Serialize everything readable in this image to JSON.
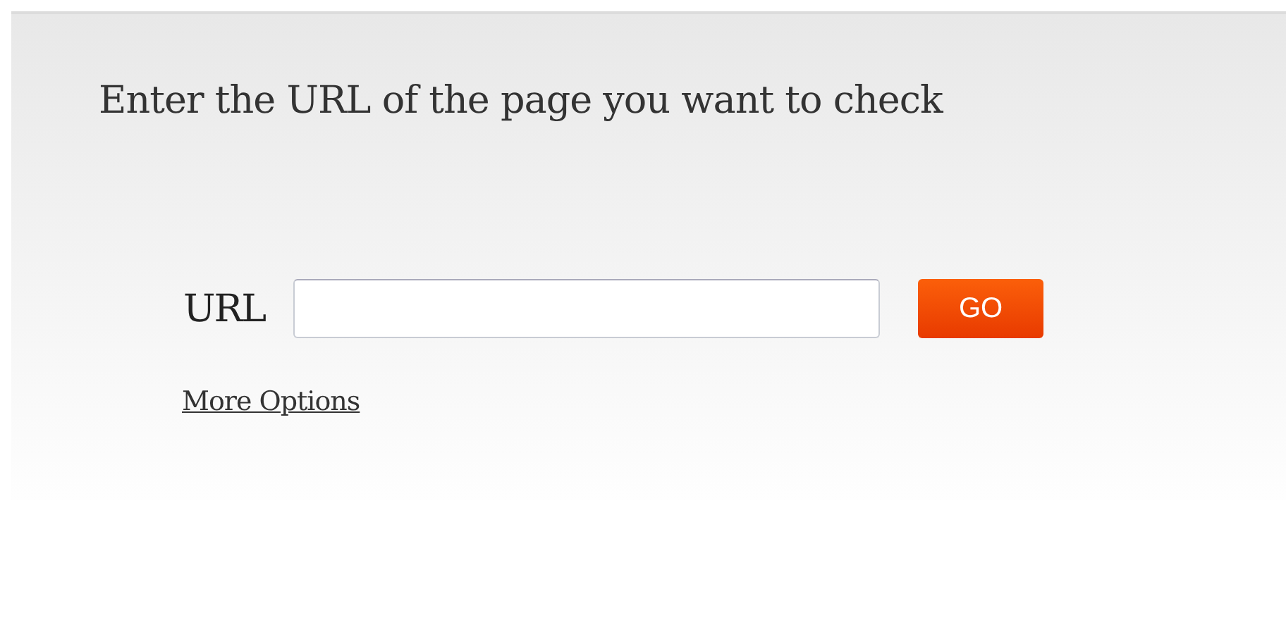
{
  "heading": "Enter the URL of the page you want to check",
  "form": {
    "label": "URL",
    "button": "GO"
  },
  "link": "More Options"
}
